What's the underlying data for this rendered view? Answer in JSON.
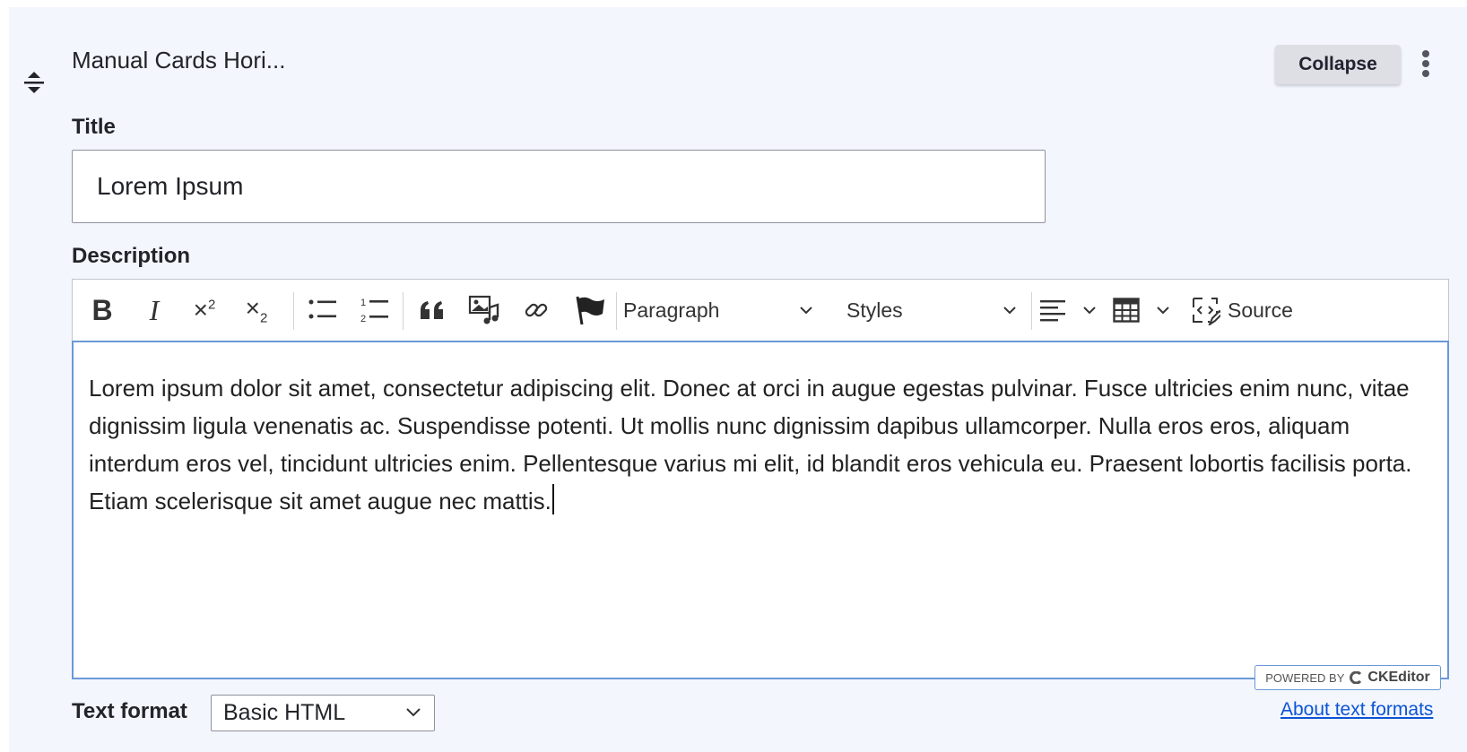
{
  "paragraph": {
    "item_title": "Manual Cards Hori...",
    "collapse_label": "Collapse"
  },
  "title_field": {
    "label": "Title",
    "value": "Lorem Ipsum"
  },
  "description": {
    "label": "Description",
    "toolbar": {
      "buttons": [
        "bold-icon",
        "italic-icon",
        "superscript-icon",
        "subscript-icon",
        "bulleted-list-icon",
        "numbered-list-icon",
        "blockquote-icon",
        "insert-media-icon",
        "link-icon",
        "anchor-flag-icon",
        "align-icon",
        "table-icon",
        "source-icon"
      ],
      "heading_value": "Paragraph",
      "styles_value": "Styles",
      "source_label": "Source"
    },
    "content": "Lorem ipsum dolor sit amet, consectetur adipiscing elit. Donec at orci in augue egestas pulvinar. Fusce ultricies enim nunc, vitae dignissim ligula venenatis ac. Suspendisse potenti. Ut mollis nunc dignissim dapibus ullamcorper. Nulla eros eros, aliquam interdum eros vel, tincidunt ultricies enim. Pellentesque varius mi elit, id blandit eros vehicula eu. Praesent lobortis facilisis porta. Etiam scelerisque sit amet augue nec mattis.",
    "powered_by": "POWERED BY",
    "powered_brand": "CKEditor"
  },
  "text_format": {
    "label": "Text format",
    "selected": "Basic HTML",
    "about_link": "About text formats"
  },
  "colors": {
    "panel_bg": "#f3f6fd",
    "focus_border": "#6a98d8",
    "link": "#0b54d6"
  }
}
